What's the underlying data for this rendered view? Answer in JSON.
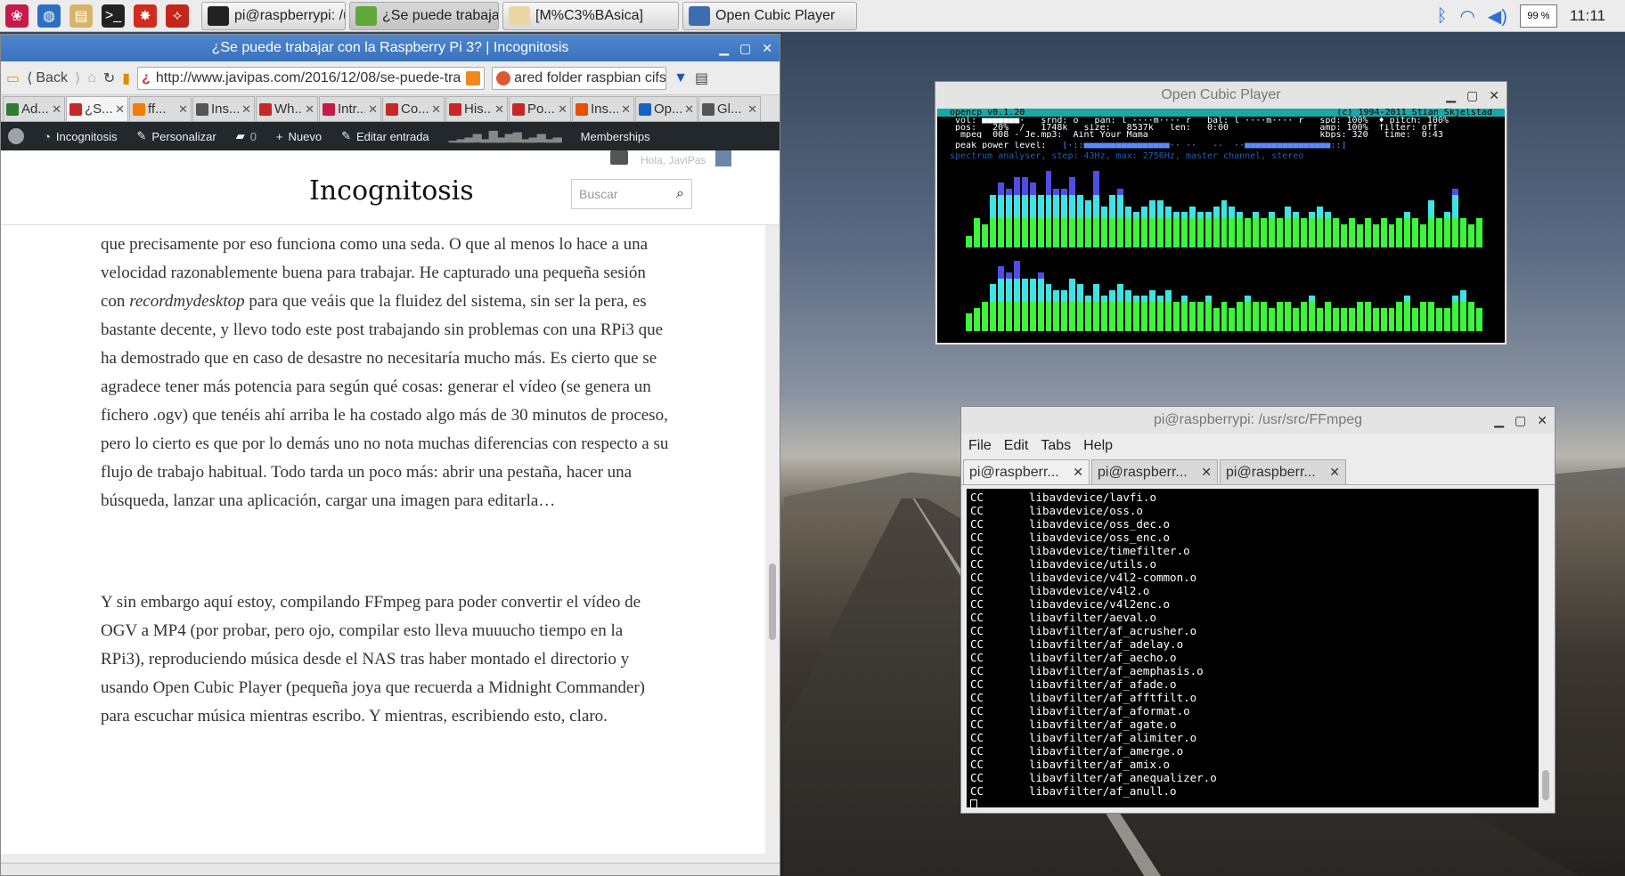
{
  "taskbar": {
    "launchers": [
      {
        "name": "raspberry-menu-icon",
        "color": "#c51a4a",
        "glyph": "❀"
      },
      {
        "name": "web-browser-icon",
        "color": "#2f6fc2",
        "glyph": "◍"
      },
      {
        "name": "file-manager-icon",
        "color": "#d8b36a",
        "glyph": "▤"
      },
      {
        "name": "terminal-icon",
        "color": "#222222",
        "glyph": ">_"
      },
      {
        "name": "math-kernel-icon",
        "color": "#d12a1e",
        "glyph": "✸"
      },
      {
        "name": "wolfram-icon",
        "color": "#c3271b",
        "glyph": "⟡"
      }
    ],
    "tasks": [
      {
        "label": "pi@raspberrypi: /usr/...",
        "icon": "terminal-task-icon",
        "color": "#222222",
        "width": 162
      },
      {
        "label": "¿Se puede trabajar c...",
        "icon": "browser-task-icon",
        "color": "#5fa83a",
        "width": 168
      },
      {
        "label": "[M%C3%BAsica]",
        "icon": "folder-task-icon",
        "color": "#e9d8a6",
        "width": 198
      },
      {
        "label": "Open Cubic Player",
        "icon": "ocp-task-icon",
        "color": "#3c6db0",
        "width": 196
      }
    ],
    "cpu": "99 %",
    "clock": "11:11"
  },
  "browser": {
    "title": "¿Se puede trabajar con la Raspberry Pi 3? | Incognitosis",
    "back_label": "Back",
    "url": "http://www.javipas.com/2016/12/08/se-puede-tra",
    "search_text": "ared folder raspbian cifs",
    "tabs": [
      {
        "label": "Ad...",
        "color": "#2e7d32"
      },
      {
        "label": "¿S...",
        "color": "#c62828"
      },
      {
        "label": "ff...",
        "color": "#f57c00"
      },
      {
        "label": "Ins...",
        "color": "#555555"
      },
      {
        "label": "Wh...",
        "color": "#c62828"
      },
      {
        "label": "Intr...",
        "color": "#c51a4a"
      },
      {
        "label": "Co...",
        "color": "#c62828"
      },
      {
        "label": "His...",
        "color": "#c62828"
      },
      {
        "label": "Po...",
        "color": "#c62828"
      },
      {
        "label": "Ins...",
        "color": "#e65100"
      },
      {
        "label": "Op...",
        "color": "#1565c0"
      },
      {
        "label": "Gl...",
        "color": "#555555"
      }
    ],
    "wp_bar": {
      "site": "Incognitosis",
      "customize": "Personalizar",
      "comments": "0",
      "new": "Nuevo",
      "edit": "Editar entrada",
      "memberships": "Memberships"
    },
    "site_title": "Incognitosis",
    "search_placeholder": "Buscar",
    "greeting": "Hola, JaviPas",
    "paragraph1_a": "que precisamente por eso funciona como una seda. O que al menos lo hace a una velocidad razonablemente buena para trabajar. He capturado una pequeña sesión con ",
    "paragraph1_em": "recordmydesktop",
    "paragraph1_b": " para que veáis que la fluidez del sistema, sin ser la pera, es bastante decente, y llevo todo este post trabajando sin problemas con una RPi3 que ha demostrado que en caso de desastre no necesitaría mucho más. Es cierto que se agradece tener más potencia para según qué cosas: generar el vídeo (se genera un fichero .ogv) que tenéis ahí arriba le ha costado algo más de 30 minutos de proceso, pero lo cierto es que por lo demás uno no nota muchas diferencias con respecto a su flujo de trabajo habitual. Todo tarda un poco más: abrir una pestaña, hacer una búsqueda, lanzar una aplicación, cargar una imagen para editarla…",
    "paragraph2": "Y sin embargo aquí estoy, compilando FFmpeg para poder convertir el vídeo de OGV a MP4 (por probar, pero ojo, compilar esto lleva muuucho tiempo en la RPi3), reproduciendo música desde el NAS tras haber montado el directorio y usando Open Cubic Player (pequeña joya que recuerda a Midnight Commander) para escuchar música mientras escribo. Y mientras, escribiendo esto, claro."
  },
  "ocp": {
    "title": "Open Cubic Player",
    "header_left": "opencp v0.1.20",
    "header_right": "(c) 1994-2011 Stian Skjelstad",
    "line1": " vol: ■■■■■■■·   srnd: o   pan: l ····m···· r   bal: l ····m···· r   spd: 100%  ♦ pitch: 100%",
    "line2": " pos:   20%  /   1748k   size:   8537k   len:   0:00                 amp: 100%  filter: off",
    "line3": "  mpeg  008 - Je.mp3:  Aint Your Mama                                kbps: 320   time:  0:43",
    "peak_label": " peak power level:",
    "peak_meter": "[·::■■■■■■■■■■■■■■■■·· ··   --  ··■■■■■■■■■■■■■■■■::]",
    "spectrum_label": " spectrum analyser, step: 43Hz, max: 2756Hz, master channel, stereo",
    "spectrum_top": [
      4,
      10,
      8,
      18,
      22,
      20,
      24,
      24,
      22,
      18,
      26,
      20,
      20,
      24,
      18,
      16,
      26,
      14,
      18,
      20,
      14,
      12,
      14,
      16,
      16,
      14,
      12,
      12,
      14,
      12,
      12,
      14,
      16,
      14,
      12,
      10,
      12,
      10,
      12,
      10,
      14,
      12,
      10,
      12,
      14,
      12,
      10,
      8,
      10,
      8,
      10,
      8,
      10,
      8,
      10,
      12,
      10,
      8,
      16,
      10,
      12,
      20,
      10,
      8,
      10
    ],
    "spectrum_bottom": [
      6,
      8,
      10,
      16,
      22,
      20,
      24,
      18,
      18,
      20,
      16,
      14,
      14,
      18,
      16,
      12,
      16,
      12,
      14,
      16,
      14,
      12,
      12,
      14,
      12,
      14,
      10,
      12,
      10,
      10,
      12,
      8,
      10,
      8,
      10,
      12,
      10,
      10,
      8,
      10,
      10,
      8,
      10,
      12,
      8,
      10,
      8,
      8,
      8,
      10,
      10,
      8,
      8,
      8,
      10,
      12,
      8,
      10,
      10,
      8,
      8,
      12,
      14,
      10,
      8
    ]
  },
  "terminal": {
    "title": "pi@raspberrypi: /usr/src/FFmpeg",
    "menu": [
      "File",
      "Edit",
      "Tabs",
      "Help"
    ],
    "tabs": [
      "pi@raspberr...",
      "pi@raspberr...",
      "pi@raspberr..."
    ],
    "lines": [
      "libavdevice/lavfi.o",
      "libavdevice/oss.o",
      "libavdevice/oss_dec.o",
      "libavdevice/oss_enc.o",
      "libavdevice/timefilter.o",
      "libavdevice/utils.o",
      "libavdevice/v4l2-common.o",
      "libavdevice/v4l2.o",
      "libavdevice/v4l2enc.o",
      "libavfilter/aeval.o",
      "libavfilter/af_acrusher.o",
      "libavfilter/af_adelay.o",
      "libavfilter/af_aecho.o",
      "libavfilter/af_aemphasis.o",
      "libavfilter/af_afade.o",
      "libavfilter/af_afftfilt.o",
      "libavfilter/af_aformat.o",
      "libavfilter/af_agate.o",
      "libavfilter/af_alimiter.o",
      "libavfilter/af_amerge.o",
      "libavfilter/af_amix.o",
      "libavfilter/af_anequalizer.o",
      "libavfilter/af_anull.o"
    ],
    "prefix": "CC"
  }
}
